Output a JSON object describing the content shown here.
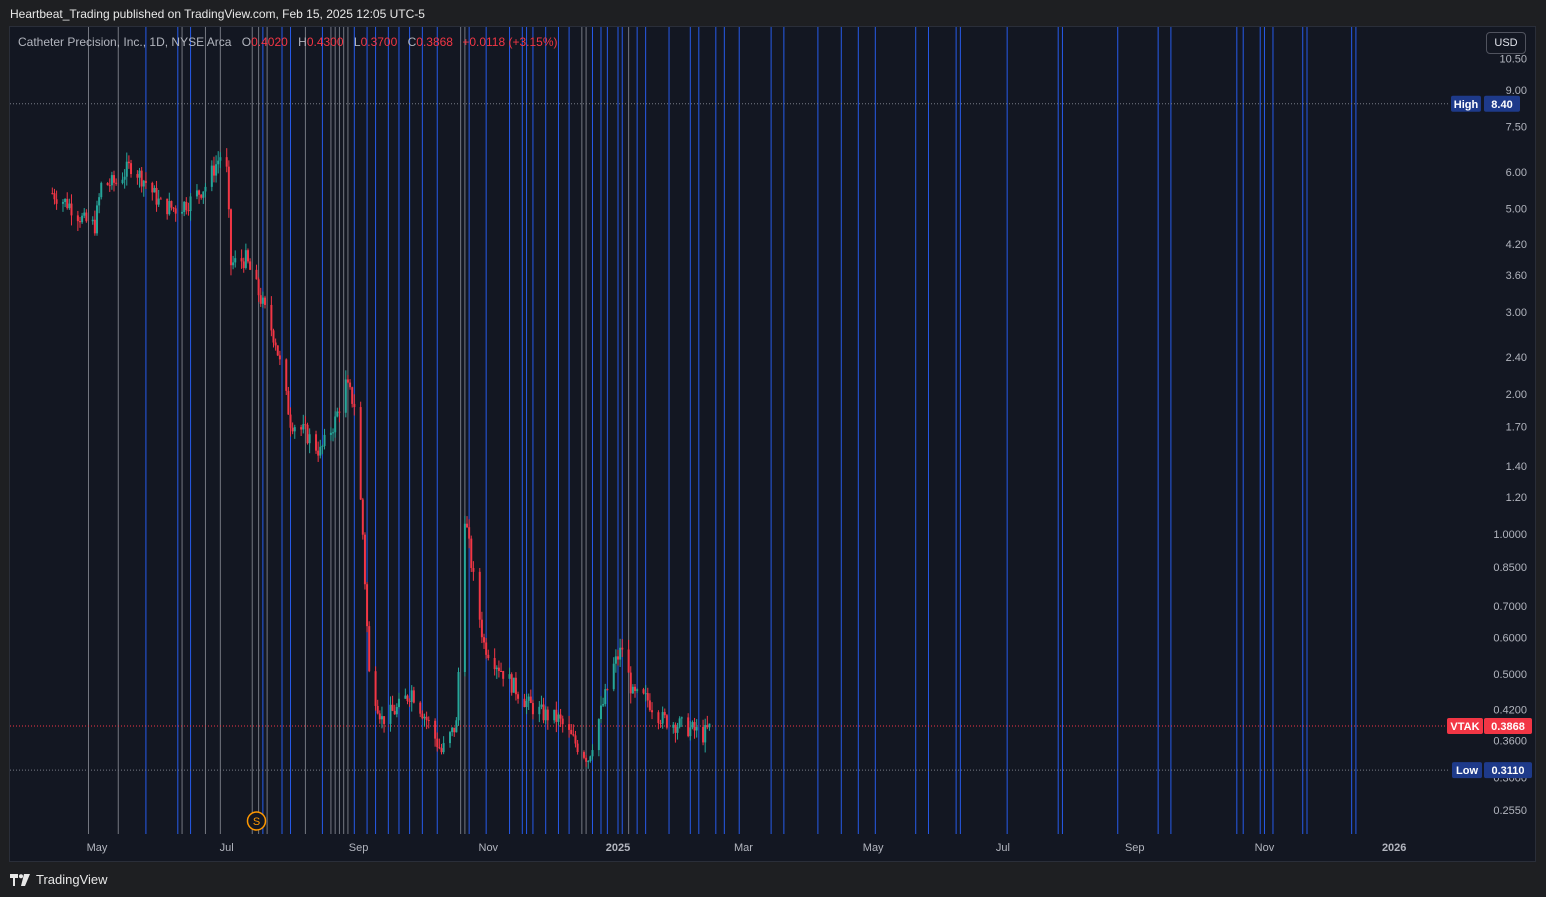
{
  "header": {
    "published_by": "Heartbeat_Trading published on TradingView.com, Feb 15, 2025 12:05 UTC-5"
  },
  "legend": {
    "symbol_line": "Catheter Precision, Inc., 1D, NYSE Arca",
    "open_key": "O",
    "open": "0.4020",
    "high_key": "H",
    "high": "0.4300",
    "low_key": "L",
    "low": "0.3700",
    "close_key": "C",
    "close": "0.3868",
    "change": "+0.0118 (+3.15%)"
  },
  "currency_button": "USD",
  "footer": {
    "brand": "TradingView"
  },
  "colors": {
    "up": "#26a69a",
    "down": "#f23645",
    "blue_lines": "#2962ff",
    "gray_lines": "#9598a1",
    "last_price_tag": "#f23645",
    "high_low_tag": "#1e3a8a"
  },
  "chart_data": {
    "type": "candlestick",
    "scale": "log",
    "ticker": "VTAK",
    "last_price": "0.3868",
    "high_marker": {
      "label": "High",
      "value": "8.40"
    },
    "low_marker": {
      "label": "Low",
      "value": "0.3110"
    },
    "y_ticks": [
      "10.50",
      "9.00",
      "7.50",
      "6.00",
      "5.00",
      "4.20",
      "3.60",
      "3.00",
      "2.40",
      "2.00",
      "1.70",
      "1.40",
      "1.20",
      "1.0000",
      "0.8500",
      "0.7000",
      "0.6000",
      "0.5000",
      "0.4200",
      "0.3600",
      "0.3000",
      "0.2550"
    ],
    "x_ticks": [
      {
        "label": "May",
        "date": "2024-05-01"
      },
      {
        "label": "Jul",
        "date": "2024-07-01"
      },
      {
        "label": "Sep",
        "date": "2024-09-01"
      },
      {
        "label": "Nov",
        "date": "2024-11-01"
      },
      {
        "label": "2025",
        "date": "2025-01-01"
      },
      {
        "label": "Mar",
        "date": "2025-03-01"
      },
      {
        "label": "May",
        "date": "2025-05-01"
      },
      {
        "label": "Jul",
        "date": "2025-07-01"
      },
      {
        "label": "Sep",
        "date": "2025-09-01"
      },
      {
        "label": "Nov",
        "date": "2025-11-01"
      },
      {
        "label": "2026",
        "date": "2026-01-01"
      }
    ],
    "x_range": [
      "2024-04-10",
      "2026-03-20"
    ],
    "event_marker": {
      "label": "S",
      "date": "2024-07-15"
    },
    "price_path": [
      {
        "date": "2024-04-10",
        "close": 5.4
      },
      {
        "date": "2024-04-18",
        "close": 5.1
      },
      {
        "date": "2024-04-25",
        "close": 4.7
      },
      {
        "date": "2024-04-30",
        "close": 4.6
      },
      {
        "date": "2024-05-03",
        "close": 5.6
      },
      {
        "date": "2024-05-10",
        "close": 5.7
      },
      {
        "date": "2024-05-17",
        "close": 6.2
      },
      {
        "date": "2024-05-24",
        "close": 5.7
      },
      {
        "date": "2024-05-31",
        "close": 5.1
      },
      {
        "date": "2024-06-07",
        "close": 5.0
      },
      {
        "date": "2024-06-14",
        "close": 5.2
      },
      {
        "date": "2024-06-21",
        "close": 5.6
      },
      {
        "date": "2024-06-28",
        "close": 6.5
      },
      {
        "date": "2024-07-01",
        "close": 6.0
      },
      {
        "date": "2024-07-03",
        "close": 3.8
      },
      {
        "date": "2024-07-10",
        "close": 3.9
      },
      {
        "date": "2024-07-17",
        "close": 3.2
      },
      {
        "date": "2024-07-24",
        "close": 2.6
      },
      {
        "date": "2024-07-31",
        "close": 1.75
      },
      {
        "date": "2024-08-07",
        "close": 1.65
      },
      {
        "date": "2024-08-14",
        "close": 1.5
      },
      {
        "date": "2024-08-21",
        "close": 1.75
      },
      {
        "date": "2024-08-26",
        "close": 2.1
      },
      {
        "date": "2024-08-30",
        "close": 1.9
      },
      {
        "date": "2024-09-03",
        "close": 1.0
      },
      {
        "date": "2024-09-06",
        "close": 0.5
      },
      {
        "date": "2024-09-12",
        "close": 0.4
      },
      {
        "date": "2024-09-19",
        "close": 0.42
      },
      {
        "date": "2024-09-26",
        "close": 0.46
      },
      {
        "date": "2024-10-03",
        "close": 0.4
      },
      {
        "date": "2024-10-10",
        "close": 0.34
      },
      {
        "date": "2024-10-17",
        "close": 0.39
      },
      {
        "date": "2024-10-21",
        "close": 1.1
      },
      {
        "date": "2024-10-25",
        "close": 0.8
      },
      {
        "date": "2024-10-30",
        "close": 0.58
      },
      {
        "date": "2024-11-06",
        "close": 0.52
      },
      {
        "date": "2024-11-13",
        "close": 0.47
      },
      {
        "date": "2024-11-20",
        "close": 0.43
      },
      {
        "date": "2024-11-27",
        "close": 0.41
      },
      {
        "date": "2024-12-04",
        "close": 0.4
      },
      {
        "date": "2024-12-11",
        "close": 0.36
      },
      {
        "date": "2024-12-18",
        "close": 0.33
      },
      {
        "date": "2024-12-23",
        "close": 0.4
      },
      {
        "date": "2024-12-30",
        "close": 0.52
      },
      {
        "date": "2025-01-03",
        "close": 0.57
      },
      {
        "date": "2025-01-08",
        "close": 0.45
      },
      {
        "date": "2025-01-15",
        "close": 0.44
      },
      {
        "date": "2025-01-22",
        "close": 0.4
      },
      {
        "date": "2025-01-29",
        "close": 0.39
      },
      {
        "date": "2025-02-05",
        "close": 0.38
      },
      {
        "date": "2025-02-10",
        "close": 0.37
      },
      {
        "date": "2025-02-14",
        "close": 0.3868
      }
    ],
    "vertical_lines": [
      {
        "date": "2024-04-27",
        "color": "gray"
      },
      {
        "date": "2024-05-11",
        "color": "gray"
      },
      {
        "date": "2024-05-24",
        "color": "blue"
      },
      {
        "date": "2024-06-08",
        "color": "blue"
      },
      {
        "date": "2024-06-10",
        "color": "gray"
      },
      {
        "date": "2024-06-14",
        "color": "blue"
      },
      {
        "date": "2024-06-21",
        "color": "gray"
      },
      {
        "date": "2024-06-28",
        "color": "gray"
      },
      {
        "date": "2024-07-13",
        "color": "gray"
      },
      {
        "date": "2024-07-16",
        "color": "gray"
      },
      {
        "date": "2024-07-18",
        "color": "blue"
      },
      {
        "date": "2024-07-20",
        "color": "gray"
      },
      {
        "date": "2024-07-27",
        "color": "blue"
      },
      {
        "date": "2024-07-31",
        "color": "blue"
      },
      {
        "date": "2024-08-07",
        "color": "gray"
      },
      {
        "date": "2024-08-15",
        "color": "blue"
      },
      {
        "date": "2024-08-19",
        "color": "gray"
      },
      {
        "date": "2024-08-21",
        "color": "gray"
      },
      {
        "date": "2024-08-23",
        "color": "gray"
      },
      {
        "date": "2024-08-25",
        "color": "gray"
      },
      {
        "date": "2024-08-27",
        "color": "gray"
      },
      {
        "date": "2024-08-30",
        "color": "blue"
      },
      {
        "date": "2024-09-05",
        "color": "blue"
      },
      {
        "date": "2024-09-09",
        "color": "blue"
      },
      {
        "date": "2024-09-15",
        "color": "blue"
      },
      {
        "date": "2024-09-20",
        "color": "blue"
      },
      {
        "date": "2024-09-25",
        "color": "blue"
      },
      {
        "date": "2024-10-01",
        "color": "blue"
      },
      {
        "date": "2024-10-08",
        "color": "blue"
      },
      {
        "date": "2024-10-19",
        "color": "gray"
      },
      {
        "date": "2024-10-21",
        "color": "gray"
      },
      {
        "date": "2024-10-23",
        "color": "blue"
      },
      {
        "date": "2024-10-31",
        "color": "blue"
      },
      {
        "date": "2024-11-11",
        "color": "blue"
      },
      {
        "date": "2024-11-17",
        "color": "blue"
      },
      {
        "date": "2024-11-19",
        "color": "blue"
      },
      {
        "date": "2024-11-22",
        "color": "blue"
      },
      {
        "date": "2024-11-28",
        "color": "blue"
      },
      {
        "date": "2024-12-04",
        "color": "blue"
      },
      {
        "date": "2024-12-09",
        "color": "blue"
      },
      {
        "date": "2024-12-15",
        "color": "gray"
      },
      {
        "date": "2024-12-17",
        "color": "gray"
      },
      {
        "date": "2024-12-20",
        "color": "blue"
      },
      {
        "date": "2024-12-24",
        "color": "blue"
      },
      {
        "date": "2024-12-27",
        "color": "blue"
      },
      {
        "date": "2025-01-01",
        "color": "blue"
      },
      {
        "date": "2025-01-03",
        "color": "blue"
      },
      {
        "date": "2025-01-06",
        "color": "gray"
      },
      {
        "date": "2025-01-10",
        "color": "blue"
      },
      {
        "date": "2025-01-14",
        "color": "blue"
      },
      {
        "date": "2025-01-25",
        "color": "blue"
      },
      {
        "date": "2025-02-04",
        "color": "blue"
      },
      {
        "date": "2025-02-08",
        "color": "blue"
      },
      {
        "date": "2025-02-16",
        "color": "blue"
      },
      {
        "date": "2025-02-20",
        "color": "blue"
      },
      {
        "date": "2025-02-27",
        "color": "blue"
      },
      {
        "date": "2025-03-14",
        "color": "blue"
      },
      {
        "date": "2025-03-20",
        "color": "blue"
      },
      {
        "date": "2025-04-05",
        "color": "blue"
      },
      {
        "date": "2025-04-16",
        "color": "blue"
      },
      {
        "date": "2025-04-24",
        "color": "blue"
      },
      {
        "date": "2025-05-02",
        "color": "blue"
      },
      {
        "date": "2025-05-21",
        "color": "blue"
      },
      {
        "date": "2025-05-27",
        "color": "blue"
      },
      {
        "date": "2025-06-09",
        "color": "blue"
      },
      {
        "date": "2025-06-11",
        "color": "blue"
      },
      {
        "date": "2025-07-03",
        "color": "blue"
      },
      {
        "date": "2025-07-27",
        "color": "blue"
      },
      {
        "date": "2025-07-29",
        "color": "blue"
      },
      {
        "date": "2025-08-24",
        "color": "blue"
      },
      {
        "date": "2025-09-12",
        "color": "blue"
      },
      {
        "date": "2025-09-18",
        "color": "blue"
      },
      {
        "date": "2025-10-19",
        "color": "blue"
      },
      {
        "date": "2025-10-22",
        "color": "blue"
      },
      {
        "date": "2025-10-30",
        "color": "blue"
      },
      {
        "date": "2025-11-01",
        "color": "blue"
      },
      {
        "date": "2025-11-05",
        "color": "blue"
      },
      {
        "date": "2025-11-19",
        "color": "blue"
      },
      {
        "date": "2025-11-21",
        "color": "blue"
      },
      {
        "date": "2025-12-12",
        "color": "blue"
      },
      {
        "date": "2025-12-14",
        "color": "blue"
      }
    ]
  }
}
